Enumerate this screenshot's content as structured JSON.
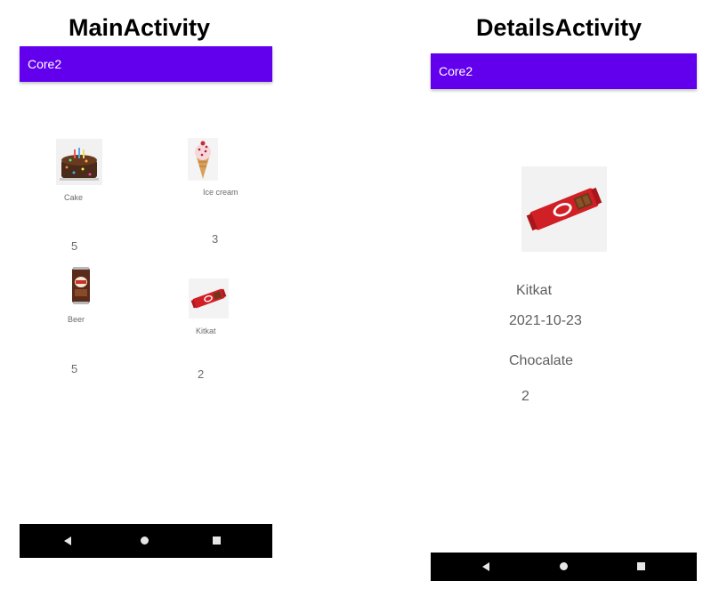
{
  "headings": {
    "main": "MainActivity",
    "details": "DetailsActivity"
  },
  "app": {
    "title": "Core2",
    "appbar_color": "#6200ee"
  },
  "main_activity": {
    "items": [
      {
        "name": "Cake",
        "quantity": "5",
        "image": "cake-image"
      },
      {
        "name": "Ice cream",
        "quantity": "3",
        "image": "ice-cream-image"
      },
      {
        "name": "Beer",
        "quantity": "5",
        "image": "beer-can-image"
      },
      {
        "name": "Kitkat",
        "quantity": "2",
        "image": "kitkat-image"
      }
    ]
  },
  "details_activity": {
    "name": "Kitkat",
    "date": "2021-10-23",
    "category": "Chocalate",
    "quantity": "2",
    "image": "kitkat-image"
  },
  "nav_icons": [
    "back-icon",
    "home-icon",
    "recents-icon"
  ]
}
